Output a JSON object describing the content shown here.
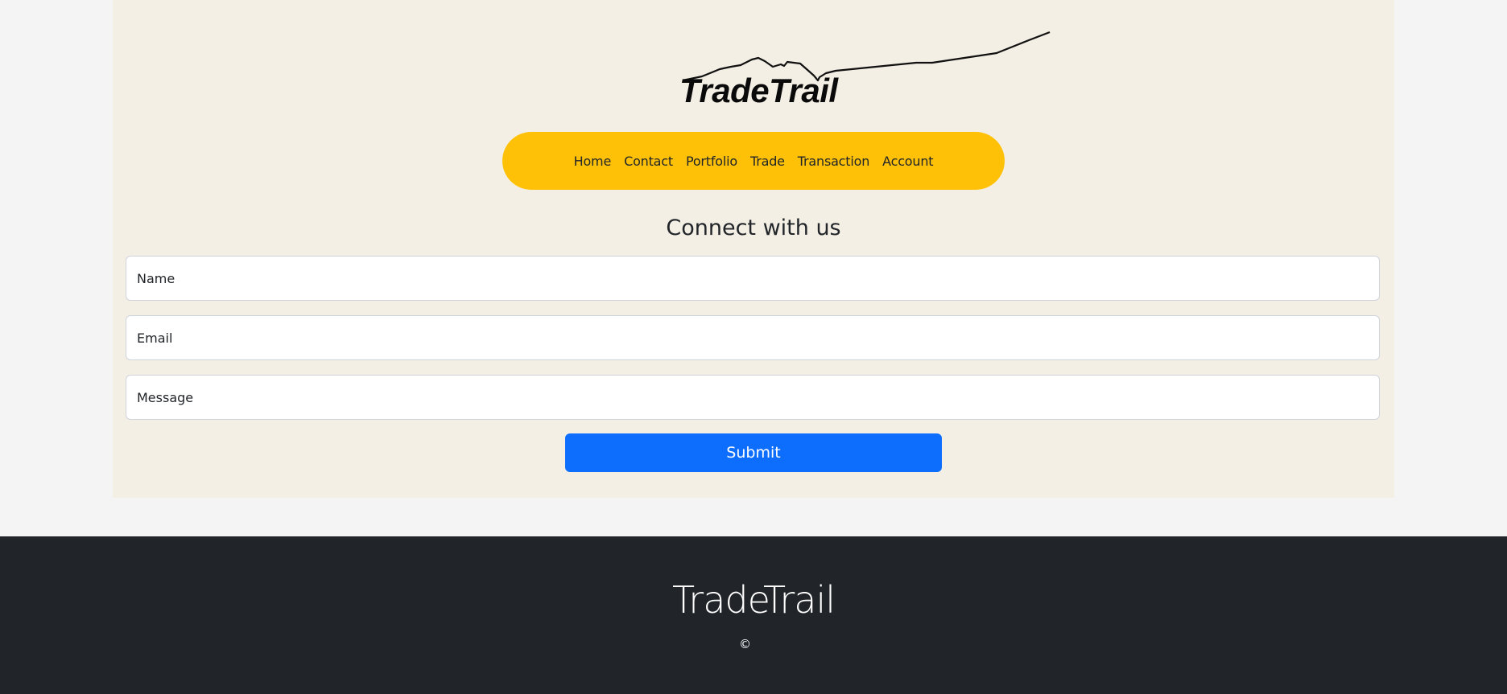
{
  "logo": {
    "text": "TradeTrail",
    "icon": "stock-line-chart-icon"
  },
  "nav": {
    "items": [
      {
        "label": "Home"
      },
      {
        "label": "Contact"
      },
      {
        "label": "Portfolio"
      },
      {
        "label": "Trade"
      },
      {
        "label": "Transaction"
      },
      {
        "label": "Account"
      }
    ]
  },
  "contact": {
    "title": "Connect with us",
    "name_placeholder": "Name",
    "email_placeholder": "Email",
    "message_placeholder": "Message",
    "submit_label": "Submit"
  },
  "footer": {
    "brand": "TradeTrail",
    "copyright": "©"
  },
  "colors": {
    "nav_background": "#ffc107",
    "primary_button": "#0d6efd",
    "page_container": "#f4efe4",
    "footer_background": "#212529"
  }
}
